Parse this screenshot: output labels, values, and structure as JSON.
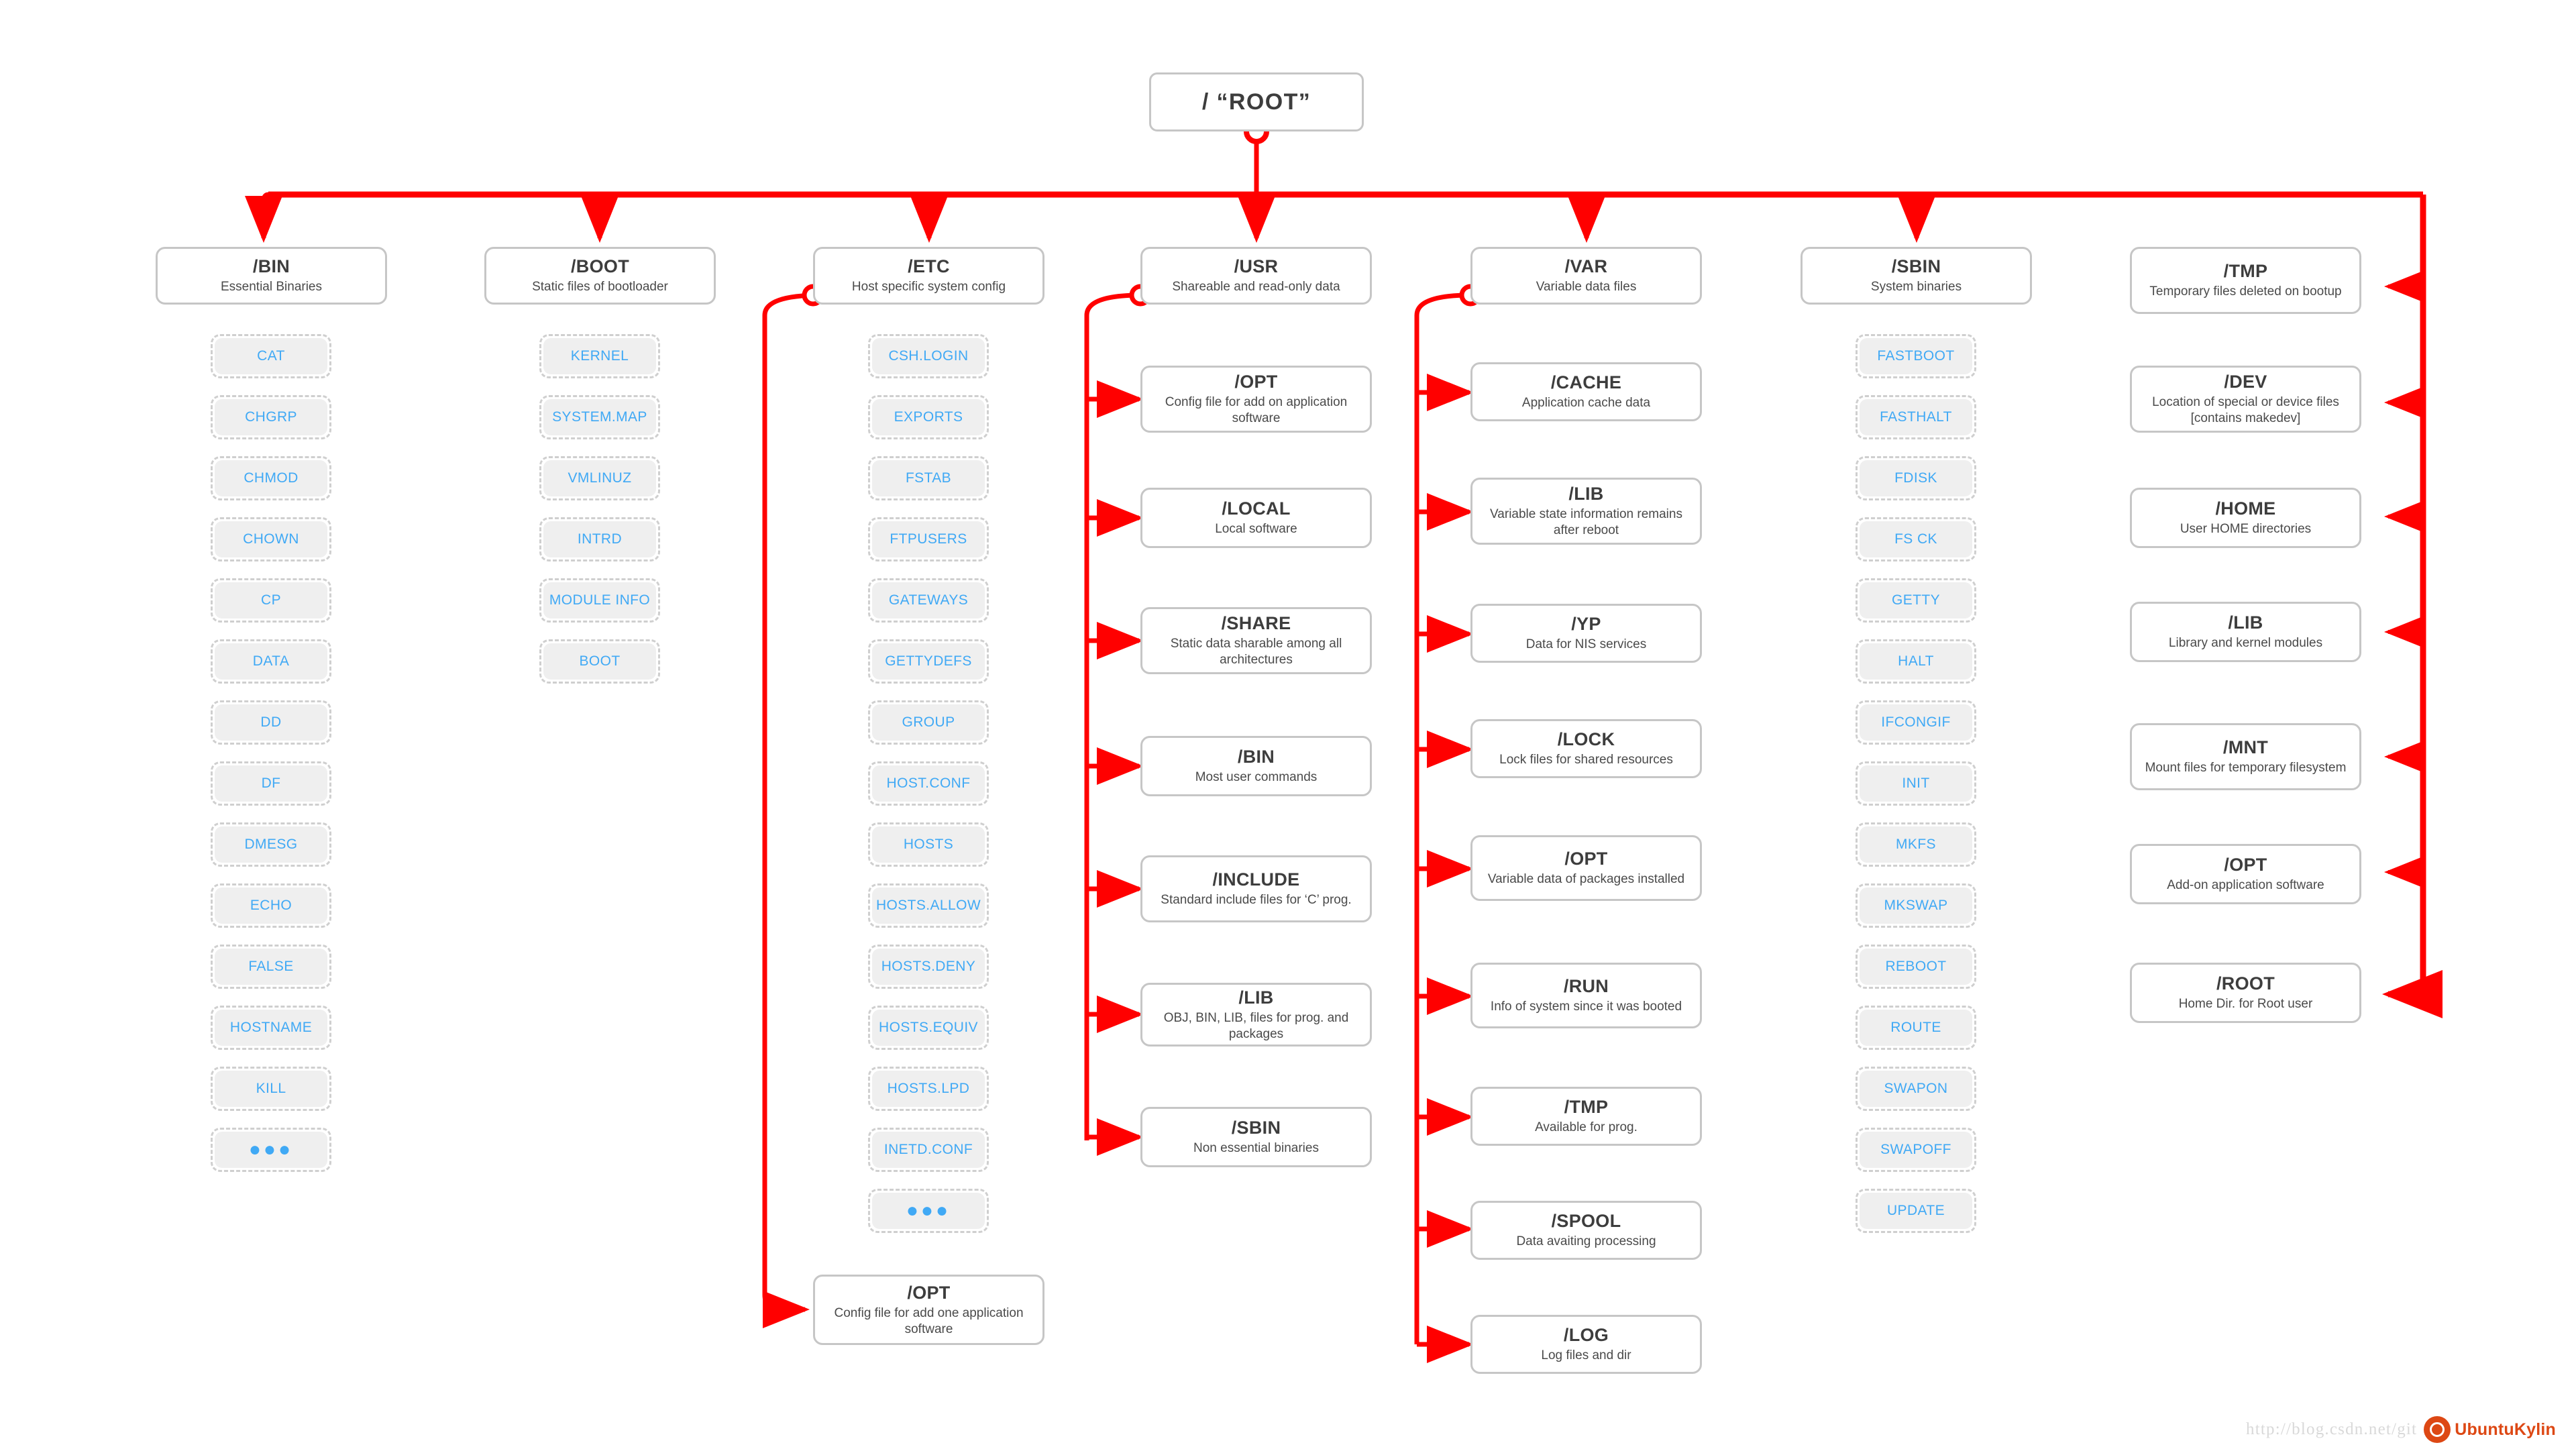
{
  "diagram": {
    "title": "Linux Filesystem Hierarchy",
    "accent_color": "#ff0000",
    "box_border_color": "#c6c6c6",
    "chip_text_color": "#40a9f5",
    "chip_fill_color": "#efefef",
    "ellipsis": "●●●"
  },
  "root": {
    "title": "/  “ROOT”"
  },
  "columns": [
    {
      "id": "bin",
      "header": {
        "title": "/BIN",
        "subtitle": "Essential Binaries"
      },
      "leaf_style": "chip",
      "leaves": [
        {
          "label": "CAT"
        },
        {
          "label": "CHGRP"
        },
        {
          "label": "CHMOD"
        },
        {
          "label": "CHOWN"
        },
        {
          "label": "CP"
        },
        {
          "label": "DATA"
        },
        {
          "label": "DD"
        },
        {
          "label": "DF"
        },
        {
          "label": "DMESG"
        },
        {
          "label": "ECHO"
        },
        {
          "label": "FALSE"
        },
        {
          "label": "HOSTNAME"
        },
        {
          "label": "KILL"
        },
        {
          "label": "●●●"
        }
      ]
    },
    {
      "id": "boot",
      "header": {
        "title": "/BOOT",
        "subtitle": "Static files of bootloader"
      },
      "leaf_style": "chip",
      "leaves": [
        {
          "label": "KERNEL"
        },
        {
          "label": "SYSTEM.MAP"
        },
        {
          "label": "VMLINUZ"
        },
        {
          "label": "INTRD"
        },
        {
          "label": "MODULE INFO"
        },
        {
          "label": "BOOT"
        }
      ]
    },
    {
      "id": "etc",
      "header": {
        "title": "/ETC",
        "subtitle": "Host specific system config"
      },
      "leaf_style": "chip",
      "leaves": [
        {
          "label": "CSH.LOGIN"
        },
        {
          "label": "EXPORTS"
        },
        {
          "label": "FSTAB"
        },
        {
          "label": "FTPUSERS"
        },
        {
          "label": "GATEWAYS"
        },
        {
          "label": "GETTYDEFS"
        },
        {
          "label": "GROUP"
        },
        {
          "label": "HOST.CONF"
        },
        {
          "label": "HOSTS"
        },
        {
          "label": "HOSTS.ALLOW"
        },
        {
          "label": "HOSTS.DENY"
        },
        {
          "label": "HOSTS.EQUIV"
        },
        {
          "label": "HOSTS.LPD"
        },
        {
          "label": "INETD.CONF"
        },
        {
          "label": "●●●"
        }
      ],
      "trailing_node": {
        "title": "/OPT",
        "subtitle": "Config file for add one application software"
      }
    },
    {
      "id": "usr",
      "header": {
        "title": "/USR",
        "subtitle": "Shareable and read-only data"
      },
      "leaf_style": "node",
      "leaves": [
        {
          "title": "/OPT",
          "subtitle": "Config file for add on application software"
        },
        {
          "title": "/LOCAL",
          "subtitle": "Local software"
        },
        {
          "title": "/SHARE",
          "subtitle": "Static data sharable among all architectures"
        },
        {
          "title": "/BIN",
          "subtitle": "Most user commands"
        },
        {
          "title": "/INCLUDE",
          "subtitle": "Standard include files for ‘C’ prog."
        },
        {
          "title": "/LIB",
          "subtitle": "OBJ, BIN, LIB, files for prog. and packages"
        },
        {
          "title": "/SBIN",
          "subtitle": "Non essential binaries"
        }
      ]
    },
    {
      "id": "var",
      "header": {
        "title": "/VAR",
        "subtitle": "Variable data files"
      },
      "leaf_style": "node",
      "leaves": [
        {
          "title": "/CACHE",
          "subtitle": "Application cache data"
        },
        {
          "title": "/LIB",
          "subtitle": "Variable state information remains after reboot"
        },
        {
          "title": "/YP",
          "subtitle": "Data for NIS services"
        },
        {
          "title": "/LOCK",
          "subtitle": "Lock files for shared resources"
        },
        {
          "title": "/OPT",
          "subtitle": "Variable data of packages installed"
        },
        {
          "title": "/RUN",
          "subtitle": "Info of system since it was booted"
        },
        {
          "title": "/TMP",
          "subtitle": "Available for prog."
        },
        {
          "title": "/SPOOL",
          "subtitle": "Data avaiting processing"
        },
        {
          "title": "/LOG",
          "subtitle": "Log files and dir"
        }
      ]
    },
    {
      "id": "sbin",
      "header": {
        "title": "/SBIN",
        "subtitle": "System binaries"
      },
      "leaf_style": "chip",
      "leaves": [
        {
          "label": "FASTBOOT"
        },
        {
          "label": "FASTHALT"
        },
        {
          "label": "FDISK"
        },
        {
          "label": "FS CK"
        },
        {
          "label": "GETTY"
        },
        {
          "label": "HALT"
        },
        {
          "label": "IFCONGIF"
        },
        {
          "label": "INIT"
        },
        {
          "label": "MKFS"
        },
        {
          "label": "MKSWAP"
        },
        {
          "label": "REBOOT"
        },
        {
          "label": "ROUTE"
        },
        {
          "label": "SWAPON"
        },
        {
          "label": "SWAPOFF"
        },
        {
          "label": "UPDATE"
        }
      ]
    },
    {
      "id": "right",
      "header": {
        "title": "/TMP",
        "subtitle": "Temporary files deleted on bootup"
      },
      "leaf_style": "node",
      "leaves": [
        {
          "title": "/DEV",
          "subtitle": "Location of special or device files [contains makedev]"
        },
        {
          "title": "/HOME",
          "subtitle": "User HOME directories"
        },
        {
          "title": "/LIB",
          "subtitle": "Library and kernel modules"
        },
        {
          "title": "/MNT",
          "subtitle": "Mount files for temporary filesystem"
        },
        {
          "title": "/OPT",
          "subtitle": "Add-on application software"
        },
        {
          "title": "/ROOT",
          "subtitle": "Home Dir. for Root user"
        }
      ]
    }
  ],
  "watermark": {
    "url": "http://blog.csdn.net/git",
    "brand": "UbuntuKylin"
  }
}
